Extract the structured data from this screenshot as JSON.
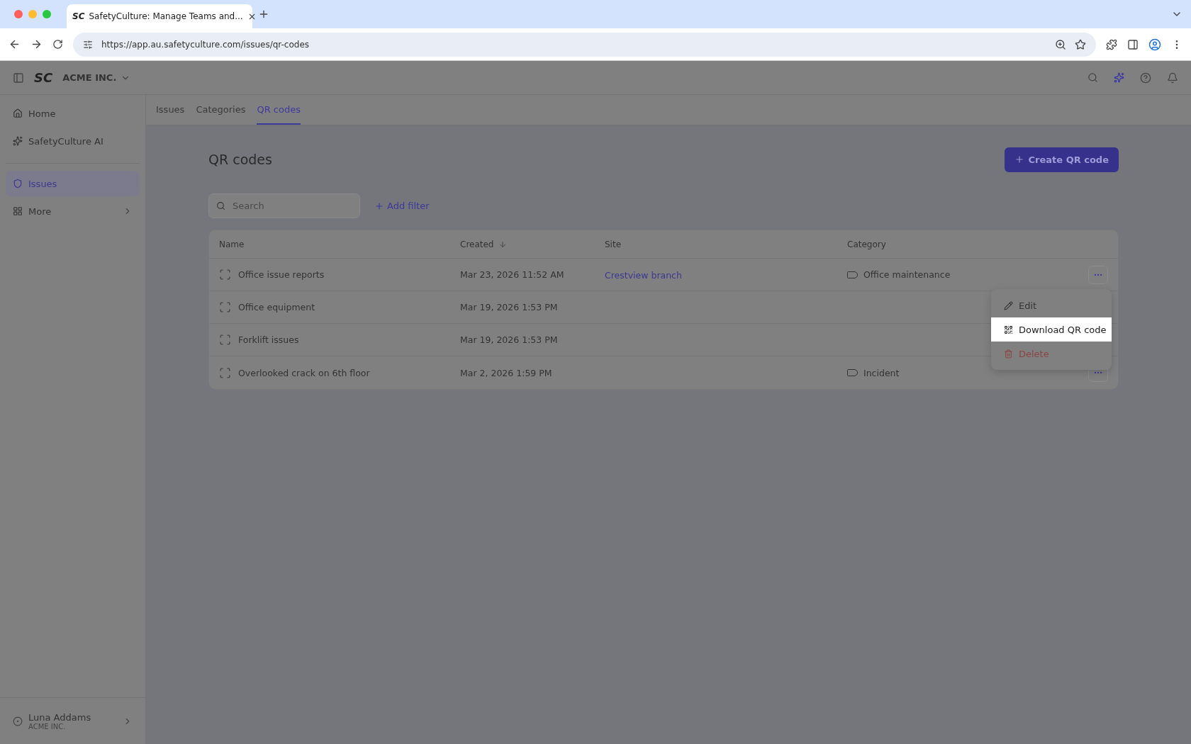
{
  "browser": {
    "favicon": "SC",
    "tab_title": "SafetyCulture: Manage Teams and...",
    "url": "https://app.au.safetyculture.com/issues/qr-codes"
  },
  "header": {
    "logo": "SC",
    "org": "ACME INC."
  },
  "sidebar": {
    "items": [
      {
        "label": "Home",
        "kind": "home",
        "selected": false
      },
      {
        "label": "SafetyCulture AI",
        "kind": "ai",
        "selected": false
      },
      {
        "label": "Issues",
        "kind": "issues",
        "selected": true
      },
      {
        "label": "More",
        "kind": "more",
        "selected": false
      }
    ],
    "user": {
      "name": "Luna Addams",
      "org": "ACME INC."
    }
  },
  "tabs": [
    {
      "label": "Issues",
      "selected": false
    },
    {
      "label": "Categories",
      "selected": false
    },
    {
      "label": "QR codes",
      "selected": true
    }
  ],
  "page": {
    "title": "QR codes",
    "create_button": "Create QR code",
    "search": {
      "placeholder": "Search"
    },
    "add_filter": "Add filter"
  },
  "table": {
    "columns": [
      {
        "label": "Name",
        "sorted": false
      },
      {
        "label": "Created",
        "sorted": true
      },
      {
        "label": "Site",
        "sorted": false
      },
      {
        "label": "Category",
        "sorted": false
      }
    ],
    "rows": [
      {
        "name": "Office issue reports",
        "created": "Mar 23, 2026 11:52 AM",
        "site": "Crestview branch",
        "category": "Office maintenance",
        "actions_visible": true
      },
      {
        "name": "Office equipment",
        "created": "Mar 19, 2026 1:53 PM",
        "actions_visible": false
      },
      {
        "name": "Forklift issues",
        "created": "Mar 19, 2026 1:53 PM",
        "actions_visible": false
      },
      {
        "name": "Overlooked crack on 6th floor",
        "created": "Mar 2, 2026 1:59 PM",
        "category": "Incident",
        "actions_visible": true
      }
    ]
  },
  "menu": {
    "items": [
      {
        "label": "Edit",
        "kind": "edit",
        "selected": false
      },
      {
        "label": "Download QR code",
        "kind": "download",
        "selected": true
      },
      {
        "label": "Delete",
        "kind": "delete",
        "selected": false
      }
    ]
  }
}
